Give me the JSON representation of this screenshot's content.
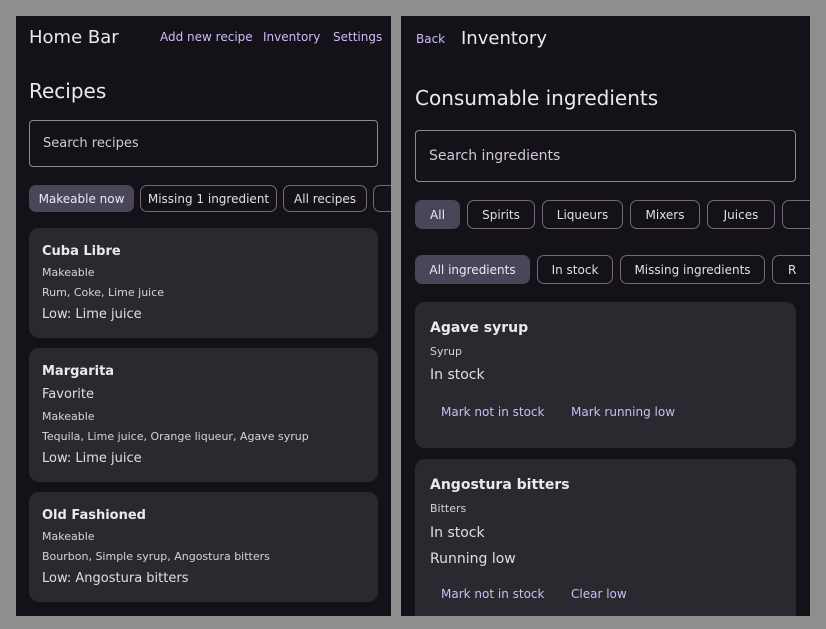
{
  "left": {
    "app_title": "Home Bar",
    "nav": {
      "add": "Add new recipe",
      "inventory": "Inventory",
      "settings": "Settings"
    },
    "heading": "Recipes",
    "search": {
      "placeholder": "Search recipes",
      "value": ""
    },
    "filters": [
      "Makeable now",
      "Missing 1 ingredient",
      "All recipes"
    ],
    "selected_filter": "Makeable now",
    "recipes": [
      {
        "name": "Cuba Libre",
        "status": "Makeable",
        "ingredients": "Rum, Coke, Lime juice",
        "low": "Low: Lime juice"
      },
      {
        "name": "Margarita",
        "favorite": "Favorite",
        "status": "Makeable",
        "ingredients": "Tequila, Lime juice, Orange liqueur, Agave syrup",
        "low": "Low: Lime juice"
      },
      {
        "name": "Old Fashioned",
        "status": "Makeable",
        "ingredients": "Bourbon, Simple syrup, Angostura bitters",
        "low": "Low: Angostura bitters"
      }
    ]
  },
  "right": {
    "back": "Back",
    "title": "Inventory",
    "heading": "Consumable ingredients",
    "search": {
      "placeholder": "Search ingredients",
      "value": ""
    },
    "category_chips": [
      "All",
      "Spirits",
      "Liqueurs",
      "Mixers",
      "Juices"
    ],
    "selected_category": "All",
    "stock_chips": [
      "All ingredients",
      "In stock",
      "Missing ingredients",
      "R"
    ],
    "selected_stock": "All ingredients",
    "ingredients": [
      {
        "name": "Agave syrup",
        "type": "Syrup",
        "stock": "In stock",
        "actions": [
          "Mark not in stock",
          "Mark running low"
        ]
      },
      {
        "name": "Angostura bitters",
        "type": "Bitters",
        "stock": "In stock",
        "low": "Running low",
        "actions": [
          "Mark not in stock",
          "Clear low"
        ]
      }
    ]
  },
  "colors": {
    "background": "#141218",
    "card": "#2b2930",
    "accent": "#cbbdf5",
    "chip_selected": "#4a4558",
    "frame": "#8f8f8f"
  }
}
